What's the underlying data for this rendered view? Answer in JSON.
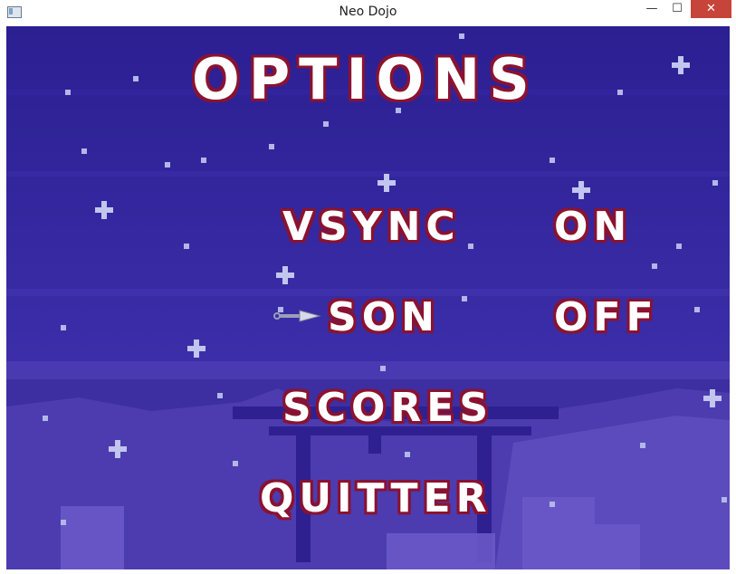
{
  "window": {
    "title": "Neo Dojo",
    "minimize_glyph": "—",
    "maximize_glyph": "☐",
    "close_glyph": "✕"
  },
  "menu": {
    "title": "OPTIONS",
    "items": [
      {
        "label": "VSYNC",
        "value": "ON"
      },
      {
        "label": "SON",
        "value": "OFF",
        "selected": true
      },
      {
        "label": "SCORES",
        "value": ""
      },
      {
        "label": "QUITTER",
        "value": ""
      }
    ]
  },
  "colors": {
    "sky_top": "#2e2296",
    "sky_bottom": "#4a3ab0",
    "ground": "#3a2a9a",
    "silhouette": "#5a48b8",
    "text": "#ffffff",
    "text_outline": "#8a1230"
  },
  "icons": {
    "cursor": "kunai-icon"
  }
}
